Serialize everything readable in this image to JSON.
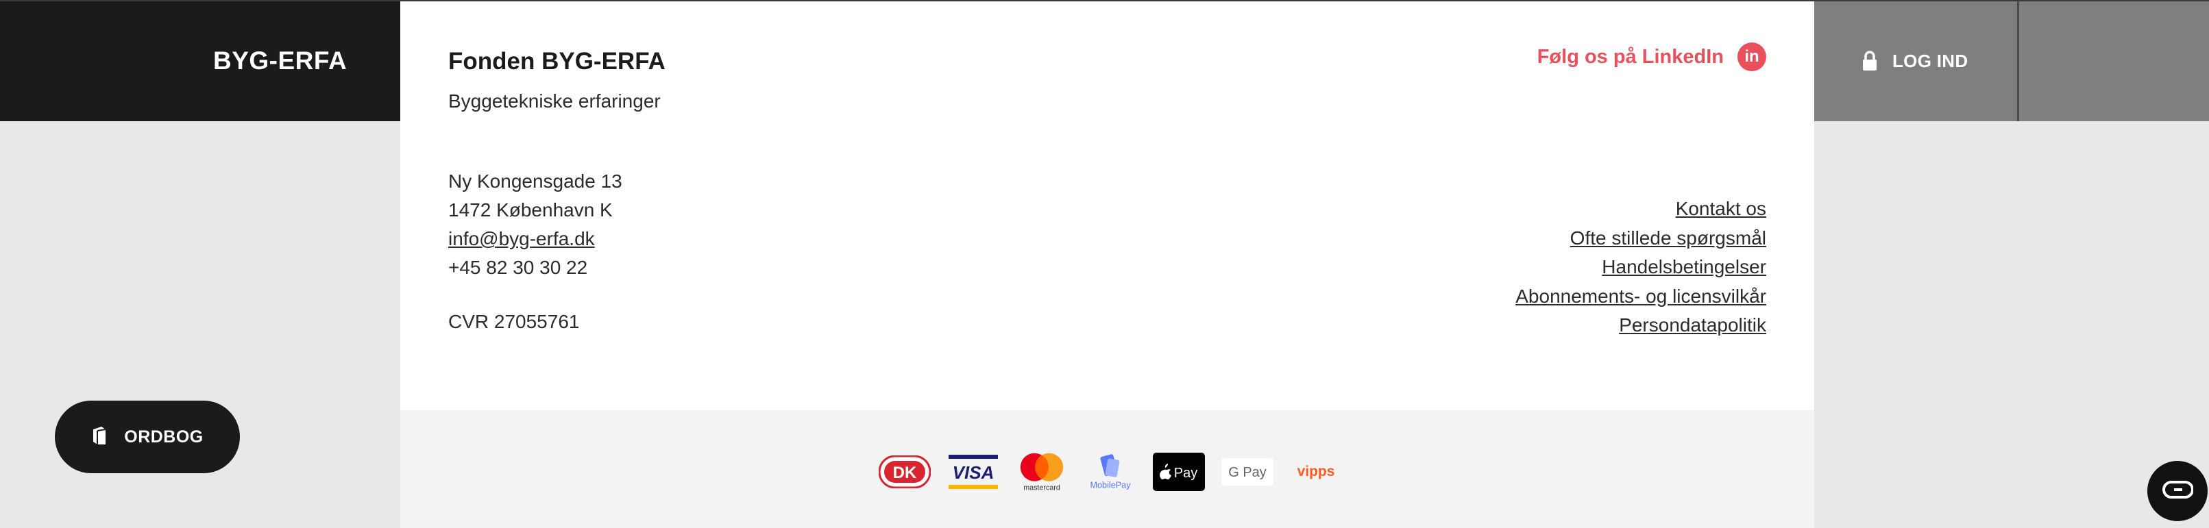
{
  "brand": {
    "title": "BYG-ERFA"
  },
  "header": {
    "login_label": "LOG IND"
  },
  "footer": {
    "org_name": "Fonden BYG-ERFA",
    "org_subtitle": "Byggetekniske erfaringer",
    "linkedin_label": "Følg os på LinkedIn",
    "linkedin_icon_text": "in",
    "address": {
      "street": "Ny Kongensgade 13",
      "city": "1472 København K",
      "email": "info@byg-erfa.dk",
      "phone": "+45 82 30 30 22",
      "cvr": "CVR 27055761"
    },
    "links": [
      {
        "label": "Kontakt os"
      },
      {
        "label": "Ofte stillede spørgsmål"
      },
      {
        "label": "Handelsbetingelser"
      },
      {
        "label": "Abonnements- og licensvilkår"
      },
      {
        "label": "Persondatapolitik"
      }
    ],
    "payment_methods": [
      {
        "name": "dankort-icon",
        "text": "DK"
      },
      {
        "name": "visa-icon",
        "text": "VISA"
      },
      {
        "name": "mastercard-icon",
        "text": "mastercard"
      },
      {
        "name": "mobilepay-icon",
        "text": "MobilePay"
      },
      {
        "name": "apple-pay-icon",
        "text": "Pay"
      },
      {
        "name": "google-pay-icon",
        "text": "G Pay"
      },
      {
        "name": "vipps-icon",
        "text": "vipps"
      }
    ]
  },
  "ordbog": {
    "label": "ORDBOG"
  },
  "colors": {
    "accent": "#e8505b",
    "header_dark": "#1b1b1b",
    "header_grey": "#7f7f7f",
    "background": "#e8e8e8"
  }
}
